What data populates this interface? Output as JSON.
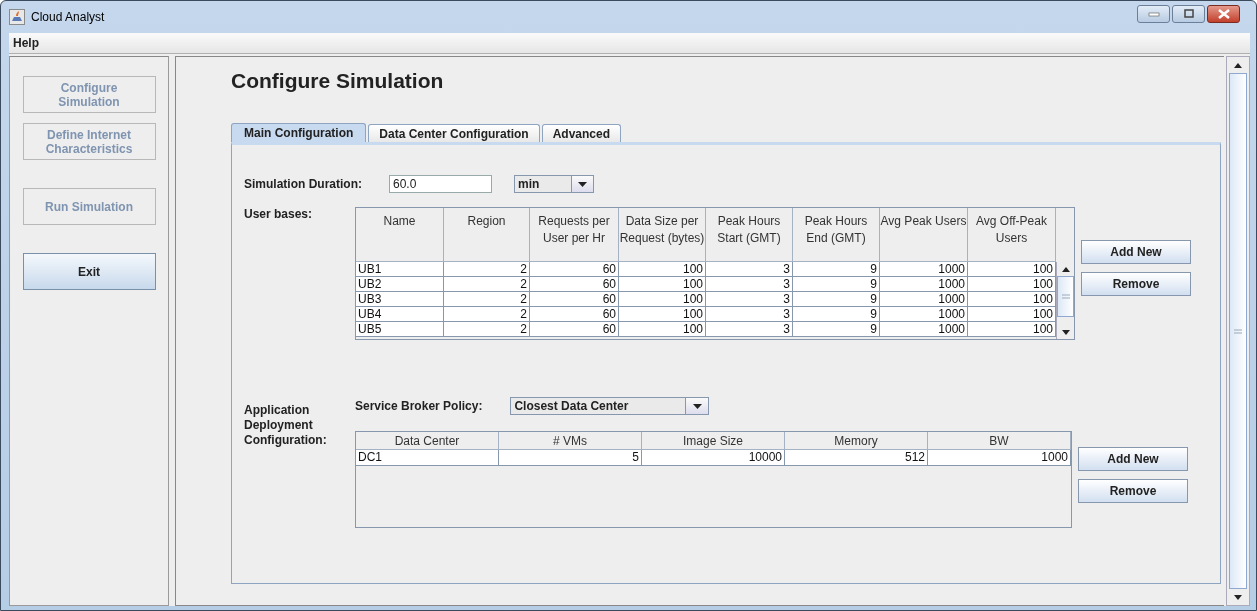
{
  "window": {
    "title": "Cloud Analyst"
  },
  "menu": [
    "Help"
  ],
  "sidebar": [
    {
      "label": "Configure Simulation",
      "disabled": true
    },
    {
      "label": "Define Internet Characteristics",
      "disabled": true
    },
    {
      "label": "Run Simulation",
      "disabled": true
    },
    {
      "label": "Exit",
      "disabled": false
    }
  ],
  "heading": "Configure Simulation",
  "tabs": [
    {
      "label": "Main Configuration",
      "selected": true
    },
    {
      "label": "Data Center Configuration",
      "selected": false
    },
    {
      "label": "Advanced",
      "selected": false
    }
  ],
  "duration": {
    "label": "Simulation Duration:",
    "value": "60.0",
    "unit": "min"
  },
  "user_bases": {
    "label": "User bases:",
    "columns": [
      "Name",
      "Region",
      "Requests per User per Hr",
      "Data Size per Request (bytes)",
      "Peak Hours Start (GMT)",
      "Peak Hours End (GMT)",
      "Avg Peak Users",
      "Avg Off-Peak Users"
    ],
    "rows": [
      [
        "UB1",
        "2",
        "60",
        "100",
        "3",
        "9",
        "1000",
        "100"
      ],
      [
        "UB2",
        "2",
        "60",
        "100",
        "3",
        "9",
        "1000",
        "100"
      ],
      [
        "UB3",
        "2",
        "60",
        "100",
        "3",
        "9",
        "1000",
        "100"
      ],
      [
        "UB4",
        "2",
        "60",
        "100",
        "3",
        "9",
        "1000",
        "100"
      ],
      [
        "UB5",
        "2",
        "60",
        "100",
        "3",
        "9",
        "1000",
        "100"
      ]
    ],
    "buttons": [
      "Add New",
      "Remove"
    ]
  },
  "deployment": {
    "label": "Application Deployment Configuration:",
    "policy_label": "Service Broker Policy:",
    "policy": "Closest Data Center",
    "columns": [
      "Data Center",
      "# VMs",
      "Image Size",
      "Memory",
      "BW"
    ],
    "rows": [
      [
        "DC1",
        "5",
        "10000",
        "512",
        "1000"
      ]
    ],
    "buttons": [
      "Add New",
      "Remove"
    ]
  }
}
